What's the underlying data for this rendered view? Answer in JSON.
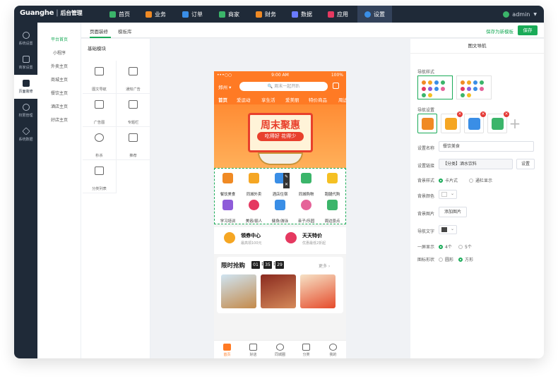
{
  "topbar": {
    "brand": "Guanghe",
    "brand_sub": "后台管理",
    "nav": [
      {
        "label": "首页",
        "icon": "home-icon",
        "color": "#3bb56a"
      },
      {
        "label": "业务",
        "icon": "grid-icon",
        "color": "#f08a24"
      },
      {
        "label": "订单",
        "icon": "order-icon",
        "color": "#3a8ee6"
      },
      {
        "label": "商家",
        "icon": "shop-icon",
        "color": "#3bb56a"
      },
      {
        "label": "财务",
        "icon": "wallet-icon",
        "color": "#f08a24"
      },
      {
        "label": "数据",
        "icon": "chart-icon",
        "color": "#6a7bff"
      },
      {
        "label": "应用",
        "icon": "cube-icon",
        "color": "#e53960"
      },
      {
        "label": "设置",
        "icon": "gear-icon",
        "color": "#3a8ee6"
      }
    ],
    "user": "admin"
  },
  "sidebar": [
    {
      "label": "系统设置",
      "icon": "settings-icon"
    },
    {
      "label": "商家设置",
      "icon": "store-icon"
    },
    {
      "label": "页面装修",
      "icon": "layout-icon"
    },
    {
      "label": "权限管理",
      "icon": "user-icon"
    },
    {
      "label": "系统数据",
      "icon": "database-icon"
    }
  ],
  "subnav": [
    "平台首页",
    "小程序",
    "外卖主页",
    "商城主页",
    "餐饮主页",
    "酒店主页",
    "好店主页"
  ],
  "tabs": [
    "页面装修",
    "模板库"
  ],
  "actions": {
    "save_template": "保存为新模板",
    "save": "保存"
  },
  "modules": {
    "title": "基础模块",
    "items": [
      {
        "label": "图文导航",
        "icon": "grid-nav-icon"
      },
      {
        "label": "通知广告",
        "icon": "megaphone-icon"
      },
      {
        "label": "广告图",
        "icon": "image-icon"
      },
      {
        "label": "专题栏",
        "icon": "layout-icon"
      },
      {
        "label": "秒杀",
        "icon": "alarm-icon"
      },
      {
        "label": "推荐",
        "icon": "thumbs-up-icon"
      },
      {
        "label": "分类列表",
        "icon": "list-icon"
      }
    ]
  },
  "phone": {
    "status": {
      "signal": "•••○○",
      "time": "9:00 AM",
      "battery": "100%"
    },
    "city": "郑州 ▾",
    "search_placeholder": "周末一起开趴",
    "categories": [
      "首页",
      "爱运动",
      "享生活",
      "爱美丽",
      "特价商品",
      "周边"
    ],
    "banner": {
      "title": "周末聚惠",
      "subtitle": "吃得好 花得少"
    },
    "icons": [
      {
        "label": "餐饮美食",
        "color": "#f08a24"
      },
      {
        "label": "同城外卖",
        "color": "#f5a623"
      },
      {
        "label": "酒店住宿",
        "color": "#3a8ee6"
      },
      {
        "label": "同城购物",
        "color": "#3bb56a"
      },
      {
        "label": "跑腿代购",
        "color": "#f5c023"
      },
      {
        "label": "学习培训",
        "color": "#8e5cd9"
      },
      {
        "label": "美容/丽人",
        "color": "#e53960"
      },
      {
        "label": "健身/游泳",
        "color": "#3a8ee6"
      },
      {
        "label": "亲子/乐园",
        "color": "#e56399"
      },
      {
        "label": "周边景点",
        "color": "#3bb56a"
      }
    ],
    "coupons": [
      {
        "title": "领券中心",
        "sub": "最高领100元"
      },
      {
        "title": "天天特价",
        "sub": "优惠最低2折起"
      }
    ],
    "flash": {
      "title": "限时抢购",
      "h": "01",
      "m": "35",
      "s": "29",
      "more": "更多 ›"
    },
    "tabbar": [
      "首页",
      "好店",
      "同城圈",
      "分类",
      "我的"
    ]
  },
  "props": {
    "title": "图文导航",
    "nav_style_label": "导航样式",
    "nav_settings_label": "导航设置",
    "name_label": "设置名称",
    "name_value": "餐饮美食",
    "link_label": "设置链接",
    "link_value": "【分类】酒水饮料",
    "link_btn": "设置",
    "bg_style_label": "背景样式",
    "bg_style_opts": [
      "卡片式",
      "通栏显示"
    ],
    "bg_color_label": "背景颜色",
    "bg_img_label": "背景图片",
    "bg_img_btn": "添加图片",
    "nav_text_label": "导航文字",
    "per_screen_label": "一屏显示",
    "per_screen_opts": [
      "4个",
      "5个"
    ],
    "shape_label": "图标形状",
    "shape_opts": [
      "圆形",
      "方形"
    ],
    "nav_text_color": "#444444",
    "accent": "#1aab58"
  }
}
